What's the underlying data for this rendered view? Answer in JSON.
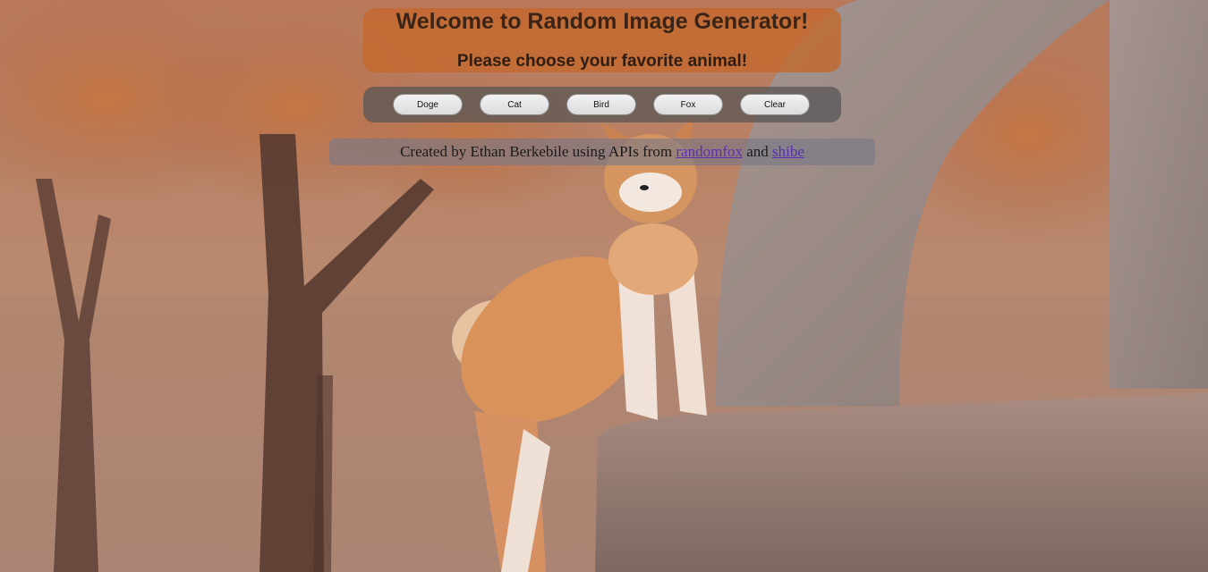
{
  "header": {
    "title": "Welcome to Random Image Generator!",
    "subtitle": "Please choose your favorite animal!"
  },
  "buttons": [
    {
      "label": "Doge"
    },
    {
      "label": "Cat"
    },
    {
      "label": "Bird"
    },
    {
      "label": "Fox"
    },
    {
      "label": "Clear"
    }
  ],
  "credit": {
    "prefix": "Created by Ethan Berkebile using APIs from",
    "link1": "randomfox",
    "middle": "and",
    "link2": "shibe"
  },
  "colors": {
    "header_bg": "#c4682c",
    "button_bar_bg": "#555555",
    "link": "#5b2fb0"
  },
  "background_image": {
    "subject": "shiba-inu dog standing on a stone ledge beside a stone arch, autumn trees behind"
  }
}
